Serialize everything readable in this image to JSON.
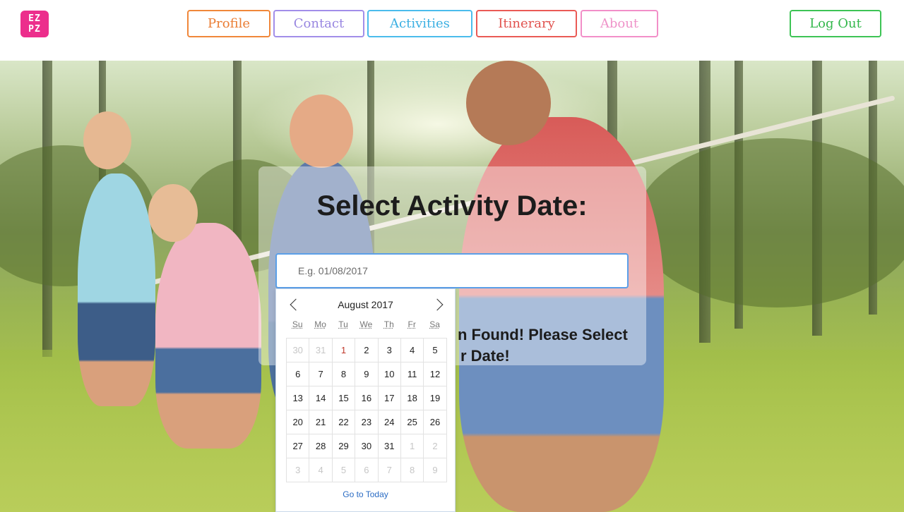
{
  "logo": {
    "line1": "EZ",
    "line2": "PZ",
    "color": "#ec2e8c"
  },
  "nav": {
    "profile": "Profile",
    "contact": "Contact",
    "activities": "Activities",
    "itinerary": "Itinerary",
    "about": "About",
    "logout": "Log Out"
  },
  "main": {
    "title": "Select Activity Date:",
    "date_input": {
      "placeholder": "E.g. 01/08/2017",
      "value": ""
    },
    "message_line1": "n Found! Please Select",
    "message_line2": "r Date!"
  },
  "calendar": {
    "month_label": "August 2017",
    "weekdays": [
      "Su",
      "Mo",
      "Tu",
      "We",
      "Th",
      "Fr",
      "Sa"
    ],
    "weeks": [
      [
        {
          "d": "30",
          "out": true
        },
        {
          "d": "31",
          "out": true
        },
        {
          "d": "1",
          "today": true
        },
        {
          "d": "2"
        },
        {
          "d": "3"
        },
        {
          "d": "4"
        },
        {
          "d": "5"
        }
      ],
      [
        {
          "d": "6"
        },
        {
          "d": "7"
        },
        {
          "d": "8"
        },
        {
          "d": "9"
        },
        {
          "d": "10"
        },
        {
          "d": "11"
        },
        {
          "d": "12"
        }
      ],
      [
        {
          "d": "13"
        },
        {
          "d": "14"
        },
        {
          "d": "15"
        },
        {
          "d": "16"
        },
        {
          "d": "17"
        },
        {
          "d": "18"
        },
        {
          "d": "19"
        }
      ],
      [
        {
          "d": "20"
        },
        {
          "d": "21"
        },
        {
          "d": "22"
        },
        {
          "d": "23"
        },
        {
          "d": "24"
        },
        {
          "d": "25"
        },
        {
          "d": "26"
        }
      ],
      [
        {
          "d": "27"
        },
        {
          "d": "28"
        },
        {
          "d": "29"
        },
        {
          "d": "30"
        },
        {
          "d": "31"
        },
        {
          "d": "1",
          "out": true
        },
        {
          "d": "2",
          "out": true
        }
      ],
      [
        {
          "d": "3",
          "out": true
        },
        {
          "d": "4",
          "out": true
        },
        {
          "d": "5",
          "out": true
        },
        {
          "d": "6",
          "out": true
        },
        {
          "d": "7",
          "out": true
        },
        {
          "d": "8",
          "out": true
        },
        {
          "d": "9",
          "out": true
        }
      ]
    ],
    "goto_today": "Go to Today",
    "prev_icon": "chevron-left-icon",
    "next_icon": "chevron-right-icon"
  },
  "colors": {
    "profile": "#f0873a",
    "contact": "#a28ee9",
    "activities": "#4bbcec",
    "itinerary": "#ea5a55",
    "about": "#f28fc8",
    "logout": "#3dc455",
    "input_focus": "#5b9fe8"
  }
}
